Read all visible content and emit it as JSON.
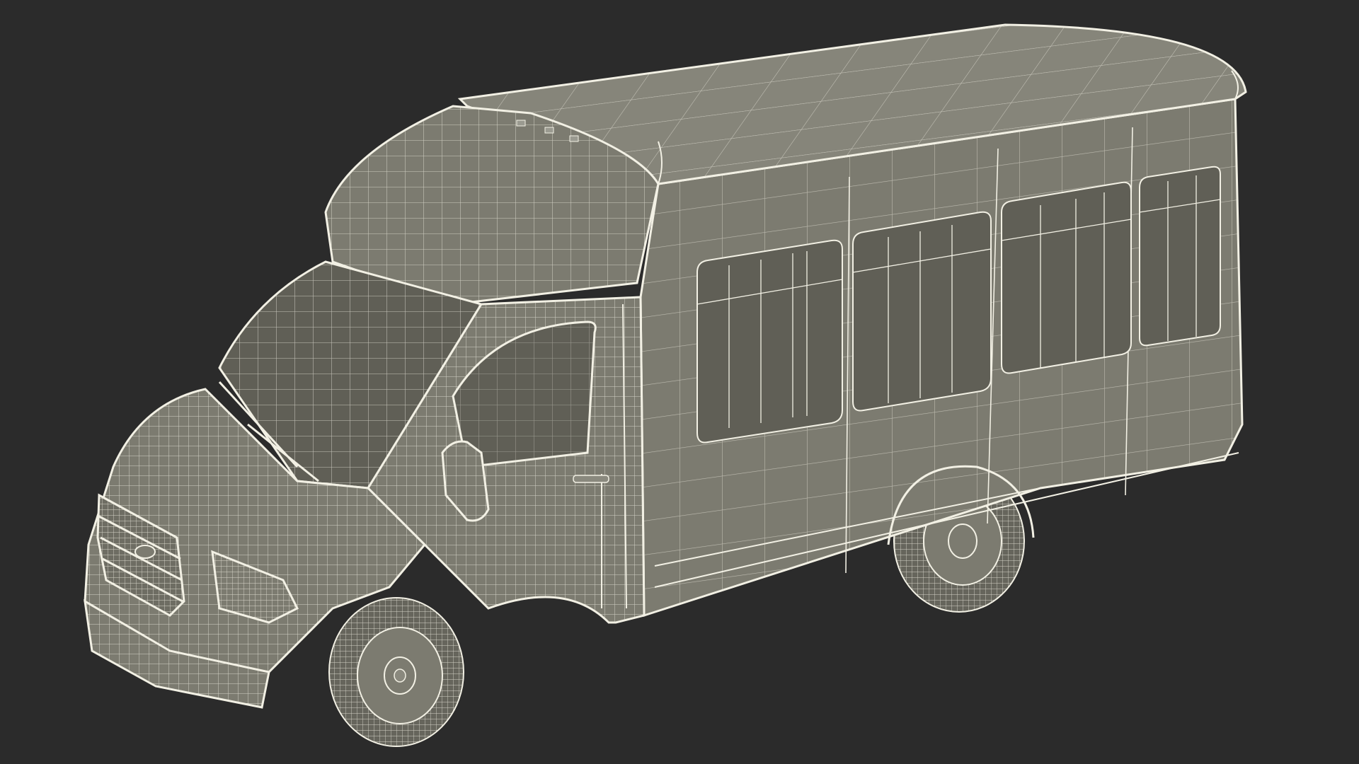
{
  "scene": {
    "subject": "",
    "background_color": "#2b2b2b",
    "body_color": "#7c7b70",
    "body_shade_color": "#6e6d63",
    "roof_color": "#86857a",
    "window_color": "#605f56",
    "tire_color": "#66655c",
    "wire_color": "#f2f0e4"
  }
}
